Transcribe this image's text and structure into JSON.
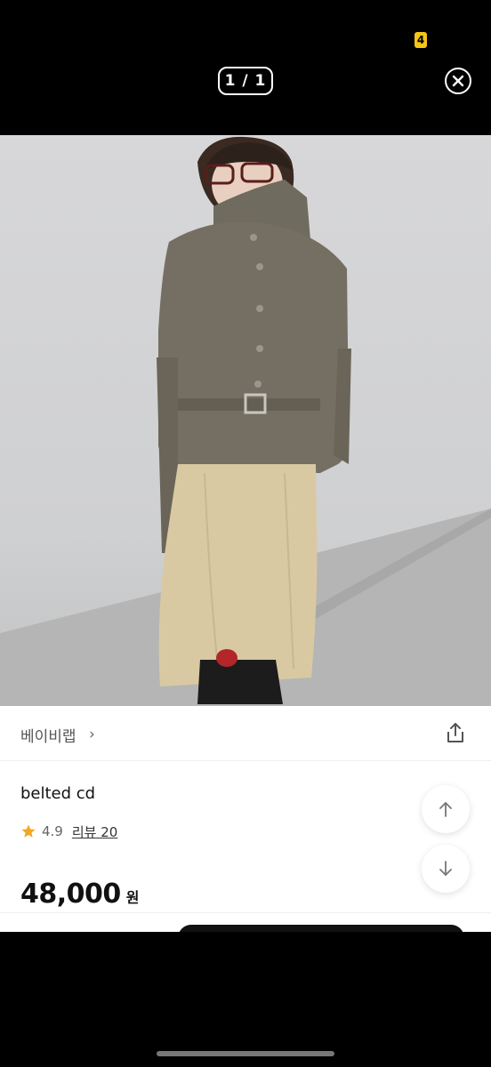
{
  "viewer": {
    "page_counter": "1 / 1",
    "status_badge": "4"
  },
  "product": {
    "brand": "베이비랩",
    "title": "belted cd",
    "rating": "4.9",
    "review_link": "리뷰 20",
    "price": "48,000",
    "currency": "원"
  },
  "colors": {
    "star": "#f5a623",
    "accent_badge": "#f5c518"
  },
  "icons": {
    "close": "close-circle-icon",
    "share": "share-icon",
    "chevron": "chevron-right-icon",
    "star": "star-icon",
    "up": "arrow-up-icon",
    "down": "arrow-down-icon"
  }
}
